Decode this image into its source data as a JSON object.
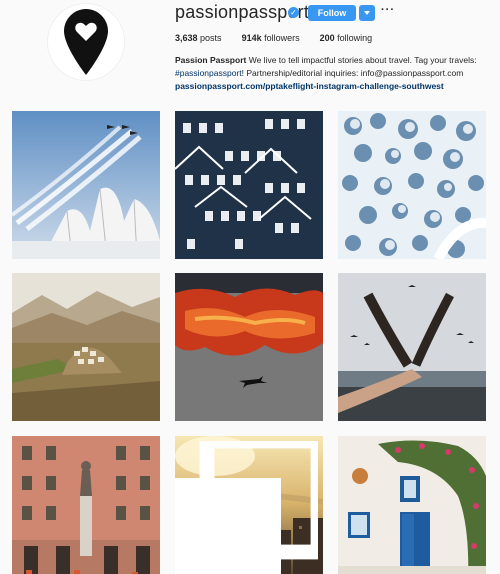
{
  "profile": {
    "username": "passionpassport",
    "follow_label": "Follow",
    "more_label": "···",
    "stats": {
      "posts_count": "3,638",
      "posts_label": "posts",
      "followers_count": "914k",
      "followers_label": "followers",
      "following_count": "200",
      "following_label": "following"
    },
    "bio": {
      "name": "Passion Passport",
      "text_1": " We live to tell impactful stories about travel. Tag your travels: ",
      "hashtag": "#passionpassport",
      "text_2": "! Partnership/editorial inquiries: info@passionpassport.com",
      "link": "passionpassport.com/pptakeflight-instagram-challenge-southwest"
    }
  },
  "colors": {
    "accent": "#3897f0",
    "link": "#003569"
  },
  "icons": {
    "avatar": "map-pin-heart-icon",
    "verified": "verified-badge-icon",
    "multi_post": "multiple-photos-icon"
  }
}
